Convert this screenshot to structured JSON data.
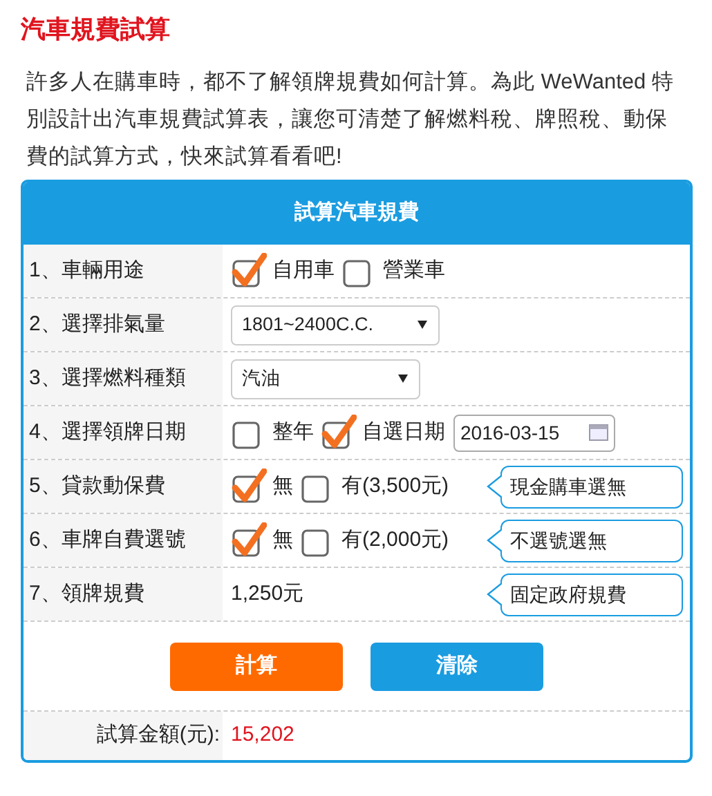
{
  "title": "汽車規費試算",
  "intro": "許多人在購車時，都不了解領牌規費如何計算。為此 WeWanted 特別設計出汽車規費試算表，讓您可清楚了解燃料稅、牌照稅、動保費的試算方式，快來試算看看吧!",
  "form": {
    "header": "試算汽車規費",
    "rows": [
      {
        "label": "1、車輛用途",
        "kind": "checks",
        "options": [
          {
            "label": "自用車",
            "checked": true
          },
          {
            "label": "營業車",
            "checked": false
          }
        ]
      },
      {
        "label": "2、選擇排氣量",
        "kind": "select",
        "value": "1801~2400C.C."
      },
      {
        "label": "3、選擇燃料種類",
        "kind": "select",
        "value": "汽油"
      },
      {
        "label": "4、選擇領牌日期",
        "kind": "checks",
        "options": [
          {
            "label": "整年",
            "checked": false
          },
          {
            "label": "自選日期",
            "checked": true
          }
        ],
        "date": "2016-03-15"
      },
      {
        "label": "5、貸款動保費",
        "kind": "checks",
        "options": [
          {
            "label": "無",
            "checked": true
          },
          {
            "label": "有(3,500元)",
            "checked": false
          }
        ],
        "tooltip": "現金購車選無"
      },
      {
        "label": "6、車牌自費選號",
        "kind": "checks",
        "options": [
          {
            "label": "無",
            "checked": true
          },
          {
            "label": "有(2,000元)",
            "checked": false
          }
        ],
        "tooltip": "不選號選無"
      },
      {
        "label": "7、領牌規費",
        "kind": "text",
        "value": "1,250元",
        "tooltip": "固定政府規費"
      }
    ],
    "buttons": [
      {
        "label": "計算",
        "kind": "primary"
      },
      {
        "label": "清除",
        "kind": "secondary"
      }
    ],
    "result_label": "試算金額(元):",
    "result_value": "15,202"
  }
}
